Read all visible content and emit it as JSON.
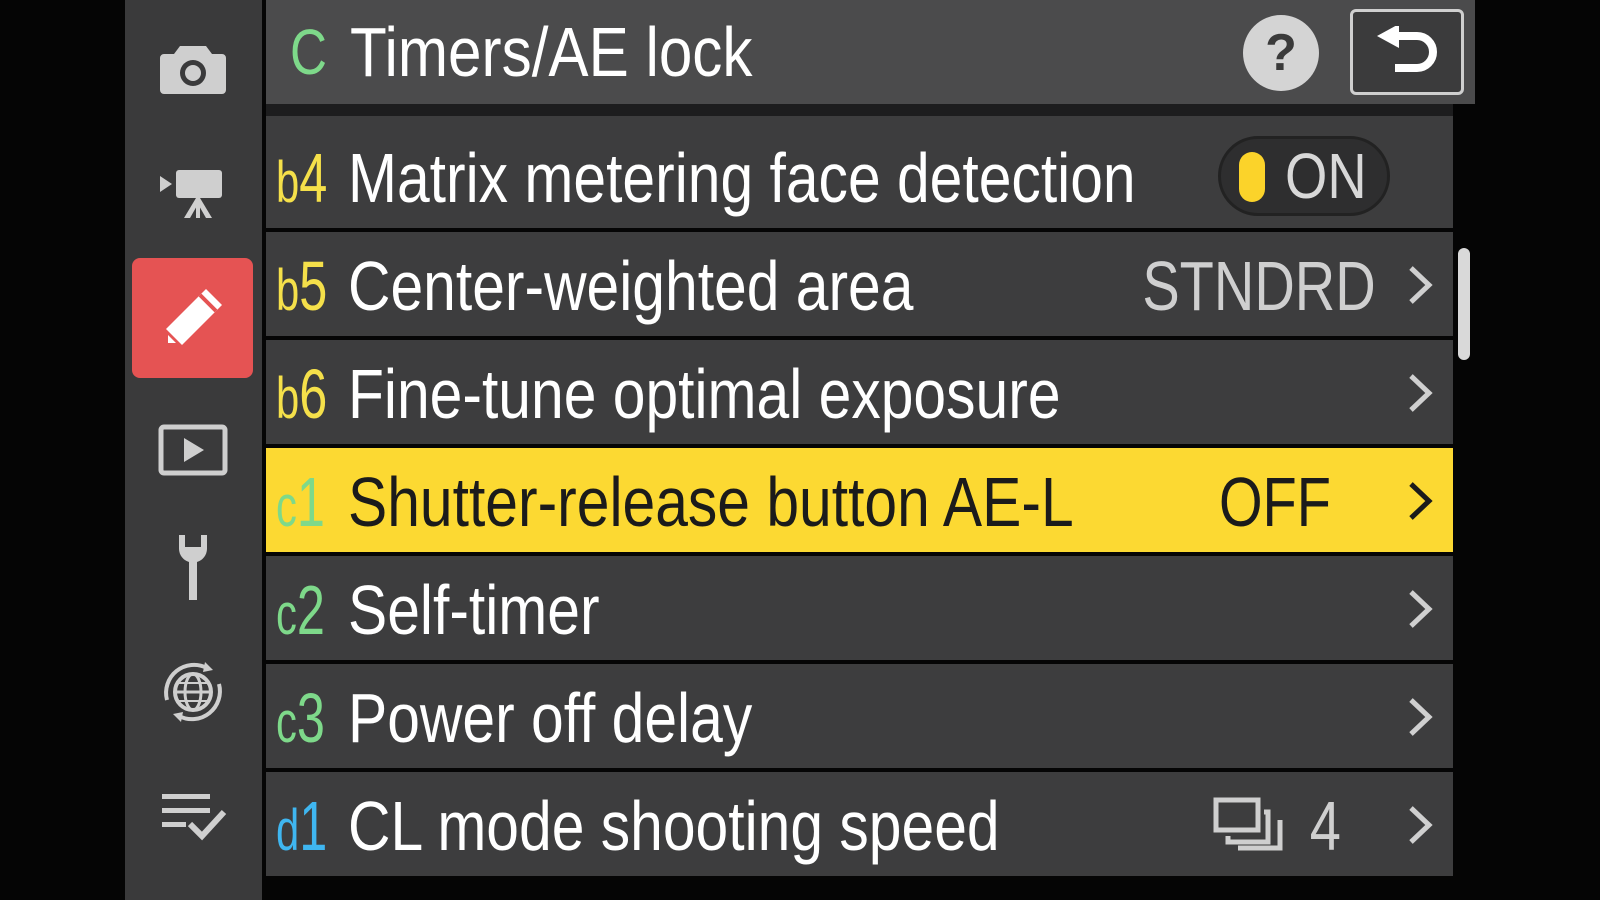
{
  "header": {
    "section_letter": "C",
    "title": "Timers/AE lock",
    "help_label": "?",
    "section_color": "#7ed98a"
  },
  "sidebar": {
    "items": [
      {
        "name": "photo-shooting-menu",
        "icon": "camera-icon",
        "active": false
      },
      {
        "name": "movie-shooting-menu",
        "icon": "movie-camera-icon",
        "active": false
      },
      {
        "name": "custom-settings-menu",
        "icon": "pencil-icon",
        "active": true
      },
      {
        "name": "playback-menu",
        "icon": "playback-icon",
        "active": false
      },
      {
        "name": "setup-menu",
        "icon": "wrench-icon",
        "active": false
      },
      {
        "name": "network-menu",
        "icon": "network-globe-icon",
        "active": false
      },
      {
        "name": "my-menu",
        "icon": "checklist-icon",
        "active": false
      }
    ],
    "active_color": "#e55353"
  },
  "menu": {
    "rows": [
      {
        "group": "b",
        "num": "4",
        "code_color": "#f5e04a",
        "label": "Matrix metering face detection",
        "value": "ON",
        "kind": "toggle",
        "selected": false
      },
      {
        "group": "b",
        "num": "5",
        "code_color": "#f5e04a",
        "label": "Center-weighted area",
        "value": "STNDRD",
        "kind": "value",
        "selected": false
      },
      {
        "group": "b",
        "num": "6",
        "code_color": "#f5e04a",
        "label": "Fine-tune optimal exposure",
        "value": "",
        "kind": "value",
        "selected": false
      },
      {
        "group": "c",
        "num": "1",
        "code_color": "#7ed98a",
        "label": "Shutter-release button AE-L",
        "value": "OFF",
        "kind": "value",
        "selected": true
      },
      {
        "group": "c",
        "num": "2",
        "code_color": "#7ed98a",
        "label": "Self-timer",
        "value": "",
        "kind": "value",
        "selected": false
      },
      {
        "group": "c",
        "num": "3",
        "code_color": "#7ed98a",
        "label": "Power off delay",
        "value": "",
        "kind": "value",
        "selected": false
      },
      {
        "group": "d",
        "num": "1",
        "code_color": "#3fb6f0",
        "label": "CL mode shooting speed",
        "value": "4",
        "value_icon": "continuous-shooting-icon",
        "kind": "value",
        "selected": false
      }
    ],
    "selected_color": "#fcd932"
  }
}
